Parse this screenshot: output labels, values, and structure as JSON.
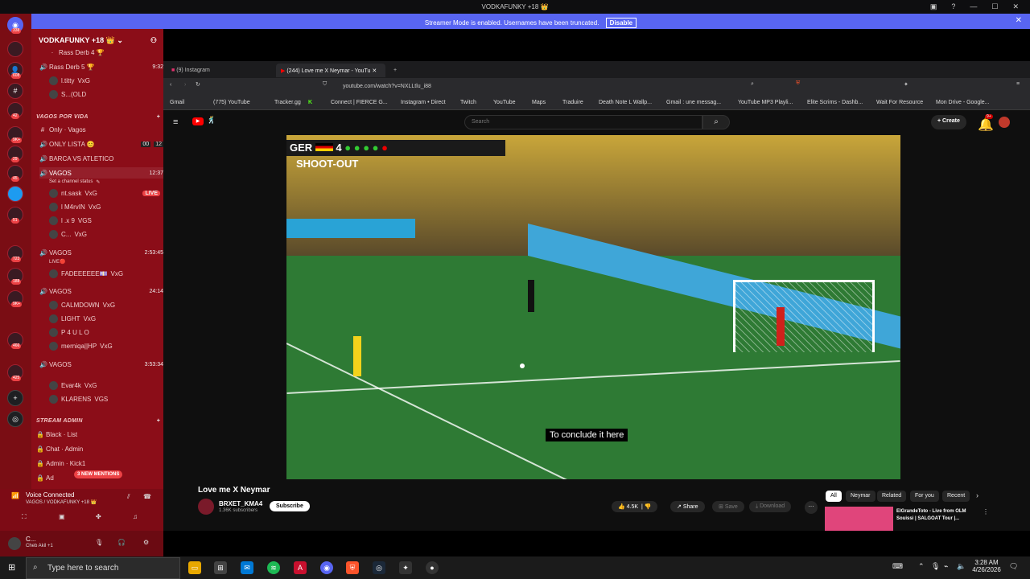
{
  "window": {
    "title": "VODKAFUNKY +18 👑"
  },
  "banner": {
    "text": "Streamer Mode is enabled. Usernames have been truncated.",
    "disable_label": "Disable"
  },
  "rail_badges": [
    "338",
    "608",
    "42",
    "9K+",
    "29",
    "45",
    "51",
    "723",
    "188",
    "9K+",
    "466",
    "425"
  ],
  "server": {
    "name": "VODKAFUNKY +18 👑"
  },
  "channels": {
    "rass4": "Rass Derb 4 🏆",
    "rass5": "Rass Derb 5 🏆",
    "rass5_time": "9:32",
    "rass_users": [
      "l.titty",
      "S...(OLD"
    ],
    "rass_tags": [
      "VxG",
      "OLD"
    ],
    "cat_vagos": "VAGOS POR VIDA",
    "only_vagos": "Only · Vagos",
    "only_lista": "ONLY LISTA 😊",
    "only_lista_counts": [
      "00",
      "12"
    ],
    "barca": "BARCA VS ATLETICO",
    "vagos1": "VAGOS",
    "vagos1_time": "12:37",
    "vagos1_status": "Set a channel status",
    "vagos1_users": [
      "nt.sask",
      "l M4rvIN",
      "l .x 9",
      "C..."
    ],
    "vagos1_tags": [
      "VxG",
      "VxG",
      "VGS",
      "VxG"
    ],
    "live_label": "LIVE",
    "vagos2": "VAGOS",
    "vagos2_time": "2:53:45",
    "vagos2_sub": "LIVE🔴",
    "vagos2_users": [
      "FADEEEEEE💷"
    ],
    "vagos2_tags": [
      "VxG"
    ],
    "vagos3": "VAGOS",
    "vagos3_time": "24:14",
    "vagos3_users": [
      "CALMDOWN",
      "LIGHT",
      "P 4 U L O",
      "merniqa||HP"
    ],
    "vagos3_tags": [
      "VxG",
      "VxG",
      "",
      "VxG"
    ],
    "vagos4": "VAGOS",
    "vagos4_time": "3:53:34",
    "vagos4_users": [
      "Evar4k",
      "KLARENS"
    ],
    "vagos4_tags": [
      "VxG",
      "VGS"
    ],
    "cat_stream": "STREAM ADMIN",
    "admin": [
      "Black · List",
      "Chat · Admin",
      "Admin · Kick1",
      "Ad"
    ],
    "mentions": "3 NEW MENTIONS"
  },
  "voice": {
    "status": "Voice Connected",
    "channel": "VAGOS / VODKAFUNKY +18 👑"
  },
  "user": {
    "name": "C...",
    "status": "Cheb Akil +1"
  },
  "browser": {
    "tabs": [
      "(9) Instagram",
      "(244) Love me X Neymar - YouTu"
    ],
    "url": "youtube.com/watch?v=NXLLtlu_i88",
    "bookmarks": [
      "Gmail",
      "(775) YouTube",
      "Tracker.gg",
      "K",
      "Connect | FIERCE G...",
      "Instagram • Direct",
      "Twitch",
      "YouTube",
      "Maps",
      "Traduire",
      "Death Note L Wallp...",
      "Gmail : une messag...",
      "YouTube MP3 Playli...",
      "Elite Scrims - Dashb...",
      "Wait For Resource",
      "Mon Drive - Google..."
    ]
  },
  "youtube": {
    "search_placeholder": "Search",
    "create_label": "Create",
    "notif_badge": "9+",
    "video_title": "Love me X Neymar",
    "channel_name": "BRXET_KMA4",
    "subscribers": "1.36K subscribers",
    "subscribe_label": "Subscribe",
    "likes": "4.5K",
    "share_label": "Share",
    "save_label": "Save",
    "download_label": "Download",
    "chips": [
      "All",
      "Neymar",
      "Related",
      "For you",
      "Recent"
    ],
    "rec_title": "ElGrandeToto - Live from OLM Souissi | SALGOAT Tour |...",
    "subtitle": "To conclude it here",
    "scoreboard_team": "GER",
    "scoreboard_score": "4",
    "shootout_label": "SHOOT-OUT"
  },
  "taskbar": {
    "search_placeholder": "Type here to search",
    "time": "3:28 AM",
    "date": "4/26/2026"
  }
}
